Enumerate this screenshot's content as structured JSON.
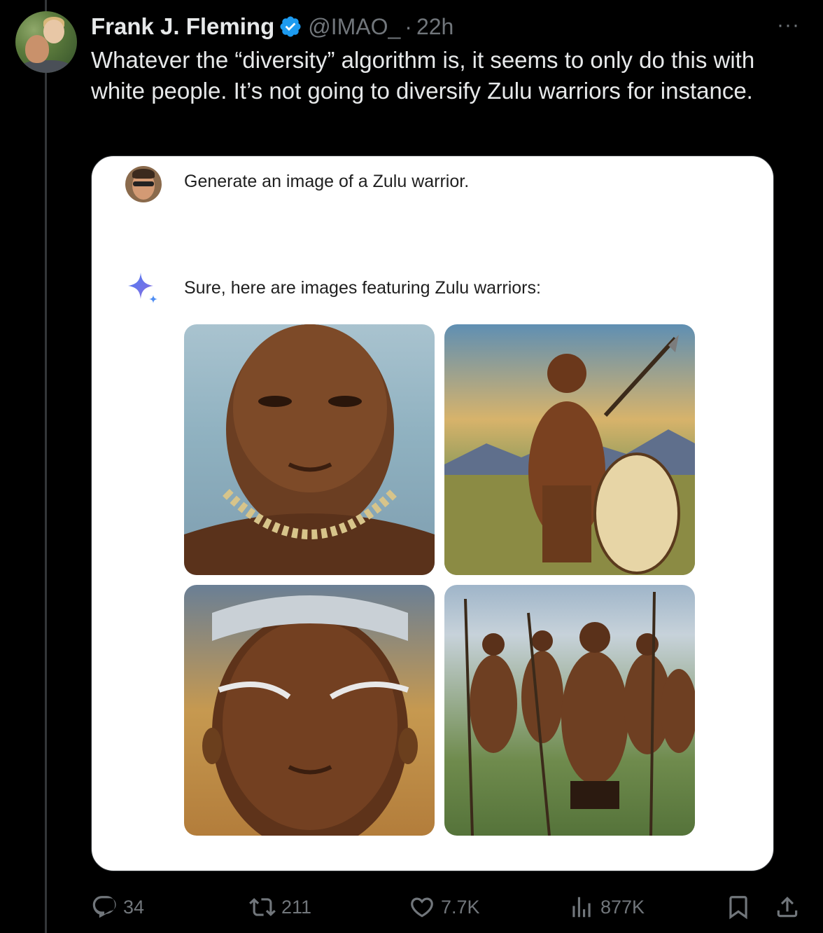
{
  "tweet": {
    "author_name": "Frank J. Fleming",
    "handle": "@IMAO_",
    "separator": "·",
    "time": "22h",
    "more_label": "···",
    "text": "Whatever the “diversity” algorithm is, it seems to only do this with white people. It’s not going to diversify Zulu warriors for instance."
  },
  "card": {
    "prompt": "Generate an image of a Zulu warrior.",
    "response": "Sure, here are images featuring Zulu warriors:",
    "images": [
      {
        "icon": "portrait-image"
      },
      {
        "icon": "warrior-with-spear-image"
      },
      {
        "icon": "painted-face-image"
      },
      {
        "icon": "group-warriors-image"
      }
    ]
  },
  "actions": {
    "replies": "34",
    "reposts": "211",
    "likes": "7.7K",
    "views": "877K"
  },
  "colors": {
    "background": "#000000",
    "text_primary": "#e7e9ea",
    "text_secondary": "#71767b",
    "verified_blue": "#1d9bf0",
    "card_bg": "#ffffff"
  }
}
